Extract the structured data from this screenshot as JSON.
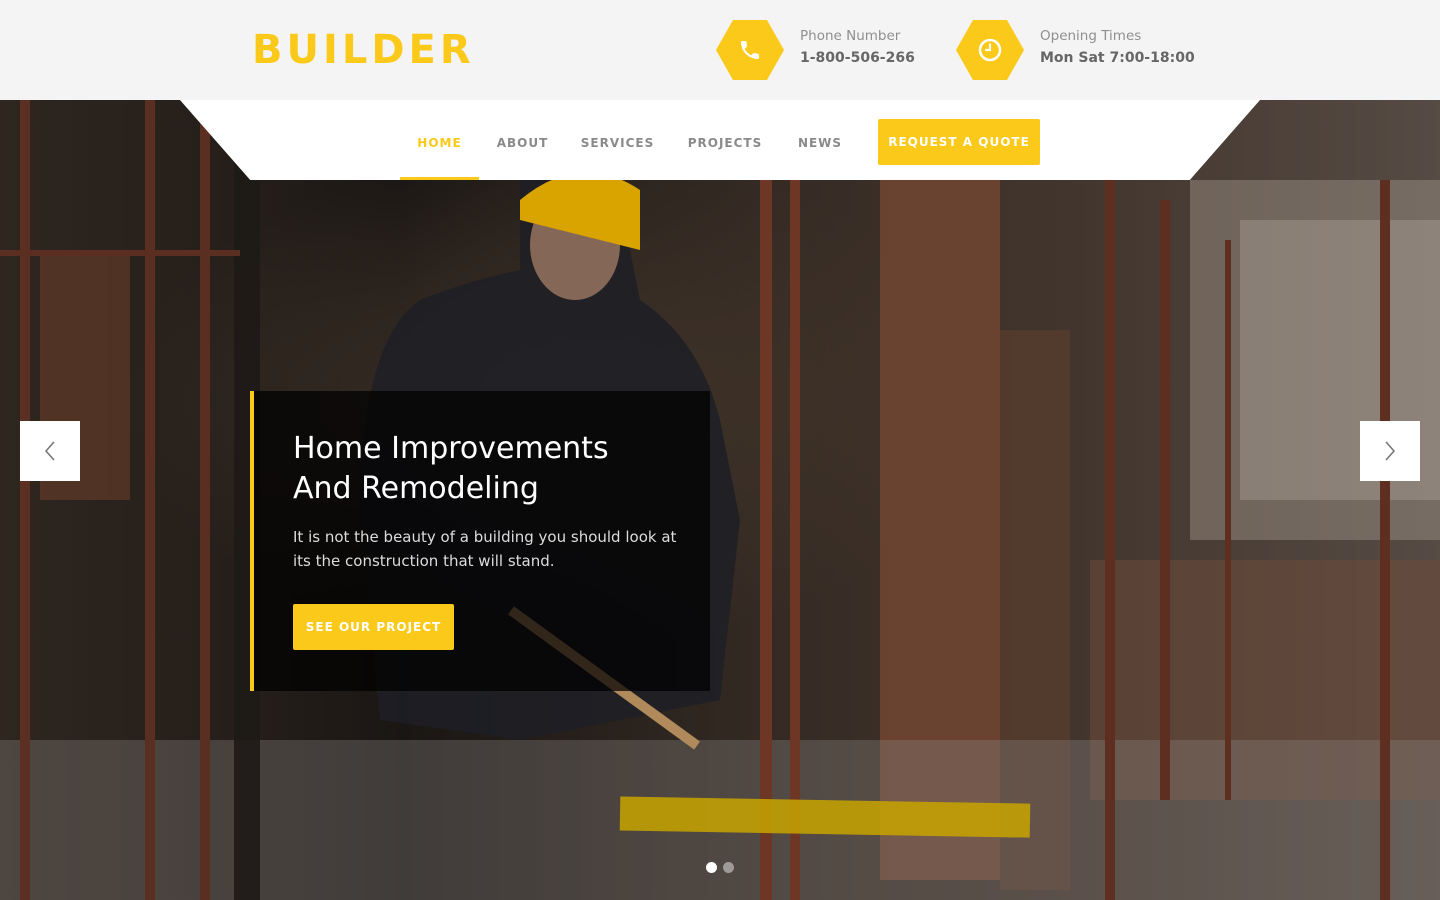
{
  "brand": {
    "logo_text": "BUILDER",
    "accent_color": "#fbc91a"
  },
  "header": {
    "phone": {
      "icon": "phone-icon",
      "label": "Phone Number",
      "value": "1-800-506-266"
    },
    "hours": {
      "icon": "clock-icon",
      "label": "Opening Times",
      "value": "Mon Sat 7:00-18:00"
    }
  },
  "nav": {
    "items": [
      {
        "label": "HOME",
        "active": true
      },
      {
        "label": "ABOUT",
        "active": false
      },
      {
        "label": "SERVICES",
        "active": false
      },
      {
        "label": "PROJECTS",
        "active": false
      },
      {
        "label": "NEWS",
        "active": false
      }
    ],
    "quote_button": "REQUEST A QUOTE"
  },
  "hero": {
    "title_line1": "Home Improvements",
    "title_line2": "And Remodeling",
    "text_line1": "It is not the beauty of a building you should look at",
    "text_line2": "its the construction that will stand.",
    "cta_label": "SEE OUR PROJECT",
    "prev_icon": "chevron-left-icon",
    "next_icon": "chevron-right-icon",
    "slides_total": 2,
    "current_slide": 1
  }
}
